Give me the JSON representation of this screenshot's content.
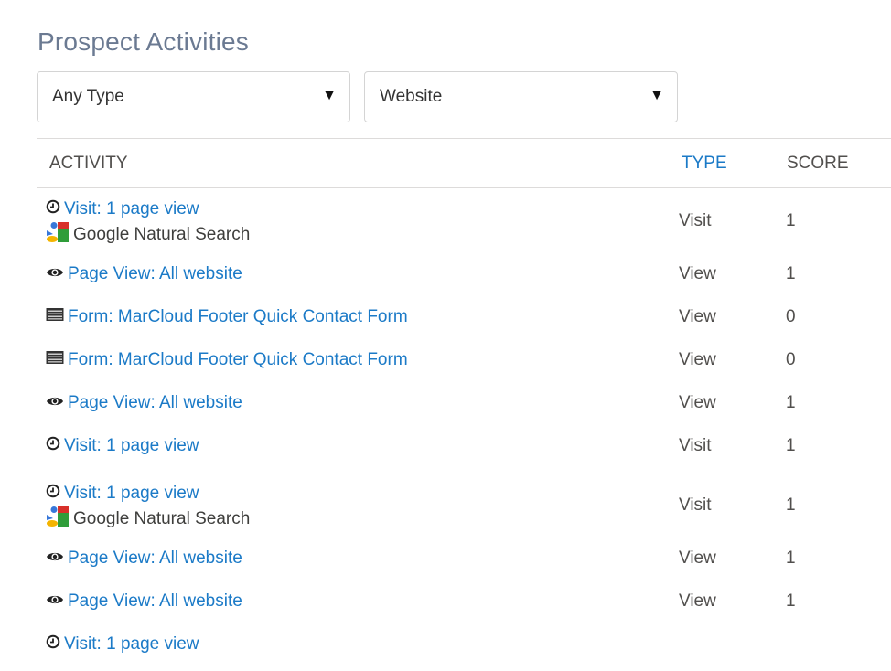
{
  "page": {
    "title": "Prospect Activities"
  },
  "filters": {
    "type_select": {
      "value": "Any Type",
      "icon": "triangle-down"
    },
    "channel_select": {
      "value": "Website",
      "icon": "triangle-down"
    }
  },
  "table": {
    "columns": {
      "activity": "ACTIVITY",
      "type": "TYPE",
      "score": "SCORE"
    },
    "rows": [
      {
        "icon": "clock-icon",
        "activity": "Visit: 1 page view",
        "source": "Google Natural Search",
        "source_icon": "google-icon",
        "type": "Visit",
        "score": "1"
      },
      {
        "icon": "eye-icon",
        "activity": "Page View: All website",
        "type": "View",
        "score": "1"
      },
      {
        "icon": "form-icon",
        "activity": "Form: MarCloud Footer Quick Contact Form",
        "type": "View",
        "score": "0"
      },
      {
        "icon": "form-icon",
        "activity": "Form: MarCloud Footer Quick Contact Form",
        "type": "View",
        "score": "0"
      },
      {
        "icon": "eye-icon",
        "activity": "Page View: All website",
        "type": "View",
        "score": "1"
      },
      {
        "icon": "clock-icon",
        "activity": "Visit: 1 page view",
        "type": "Visit",
        "score": "1"
      },
      {
        "icon": "clock-icon",
        "activity": "Visit: 1 page view",
        "source": "Google Natural Search",
        "source_icon": "google-icon",
        "type": "Visit",
        "score": "1"
      },
      {
        "icon": "eye-icon",
        "activity": "Page View: All website",
        "type": "View",
        "score": "1"
      },
      {
        "icon": "eye-icon",
        "activity": "Page View: All website",
        "type": "View",
        "score": "1"
      },
      {
        "icon": "clock-icon",
        "activity": "Visit: 1 page view",
        "type": "",
        "score": ""
      }
    ]
  },
  "colors": {
    "link": "#1b7ac7",
    "title": "#6b7a92",
    "border": "#dddbda"
  }
}
